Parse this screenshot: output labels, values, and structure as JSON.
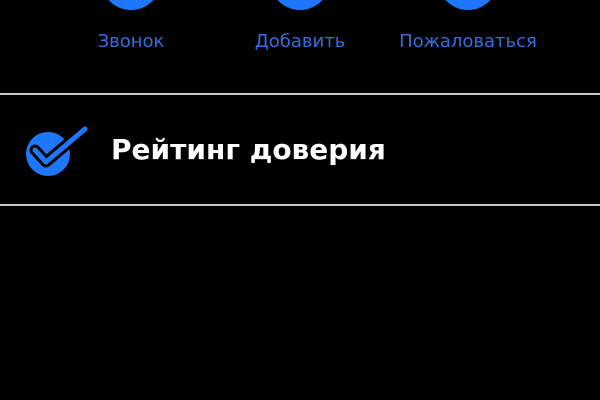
{
  "actions": {
    "call": {
      "label": "Звонок",
      "icon": "phone-icon"
    },
    "add": {
      "label": "Добавить",
      "icon": "add-contact-icon"
    },
    "report": {
      "label": "Пожаловаться",
      "icon": "report-icon"
    }
  },
  "trust": {
    "label": "Рейтинг доверия",
    "icon": "verified-check-icon"
  },
  "colors": {
    "background": "#000000",
    "accent": "#1e78ff",
    "action_label": "#2f6fe0",
    "primary_text": "#ffffff",
    "divider": "#c8c8c8"
  }
}
